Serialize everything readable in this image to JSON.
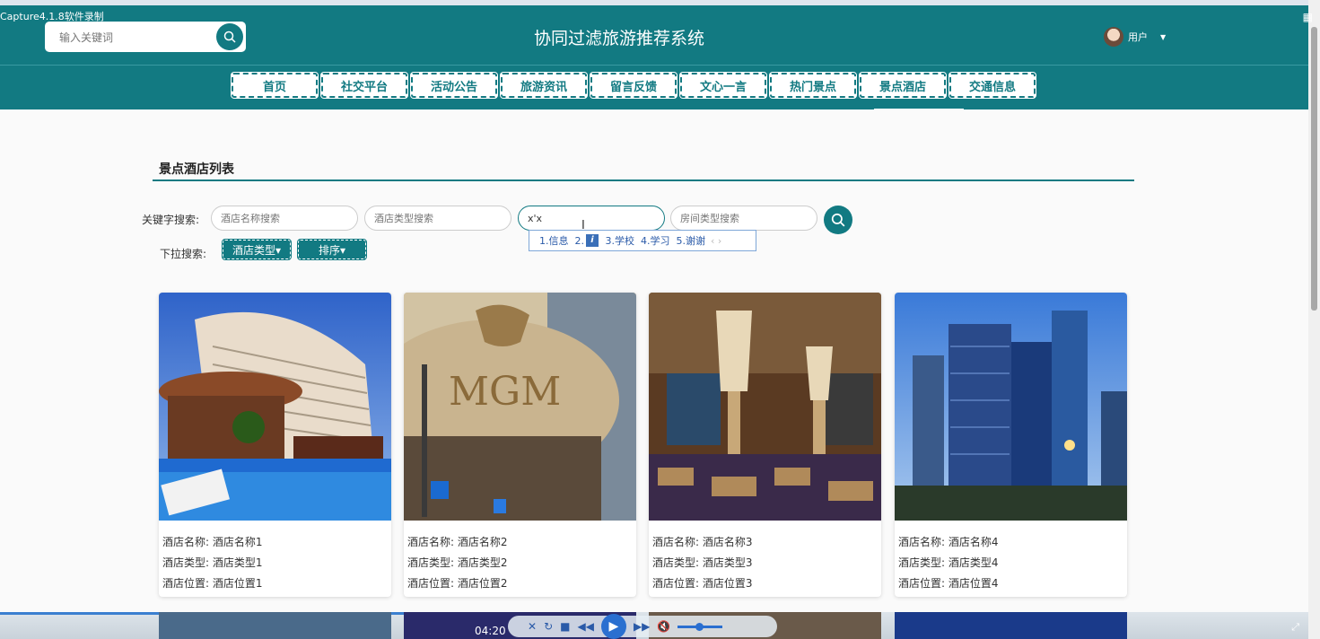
{
  "recorder_caption": "Capture4.1.8软件录制",
  "header": {
    "search_placeholder": "输入关键词",
    "site_title": "协同过滤旅游推荐系统",
    "user_label": "用户"
  },
  "nav": {
    "items": [
      "首页",
      "社交平台",
      "活动公告",
      "旅游资讯",
      "留言反馈",
      "文心一言",
      "热门景点",
      "景点酒店",
      "交通信息"
    ],
    "active": "景点酒店"
  },
  "section": {
    "title": "景点酒店列表"
  },
  "search": {
    "keyword_label": "关键字搜索:",
    "name_placeholder": "酒店名称搜索",
    "type_placeholder": "酒店类型搜索",
    "active_value": "x'x",
    "room_placeholder": "房间类型搜索",
    "dropdown_label": "下拉搜索:",
    "hotel_type_btn": "酒店类型▾",
    "sort_btn": "排序▾"
  },
  "ime": {
    "c1": "1.信息",
    "c2": "2.",
    "c3": "3.学校",
    "c4": "4.学习",
    "c5": "5.谢谢"
  },
  "hotels": [
    {
      "name": "酒店名称: 酒店名称1",
      "type": "酒店类型: 酒店类型1",
      "location": "酒店位置: 酒店位置1"
    },
    {
      "name": "酒店名称: 酒店名称2",
      "type": "酒店类型: 酒店类型2",
      "location": "酒店位置: 酒店位置2"
    },
    {
      "name": "酒店名称: 酒店名称3",
      "type": "酒店类型: 酒店类型3",
      "location": "酒店位置: 酒店位置3"
    },
    {
      "name": "酒店名称: 酒店名称4",
      "type": "酒店类型: 酒店类型4",
      "location": "酒店位置: 酒店位置4"
    }
  ],
  "player": {
    "time": "04:20"
  },
  "colors": {
    "primary": "#127a82"
  }
}
